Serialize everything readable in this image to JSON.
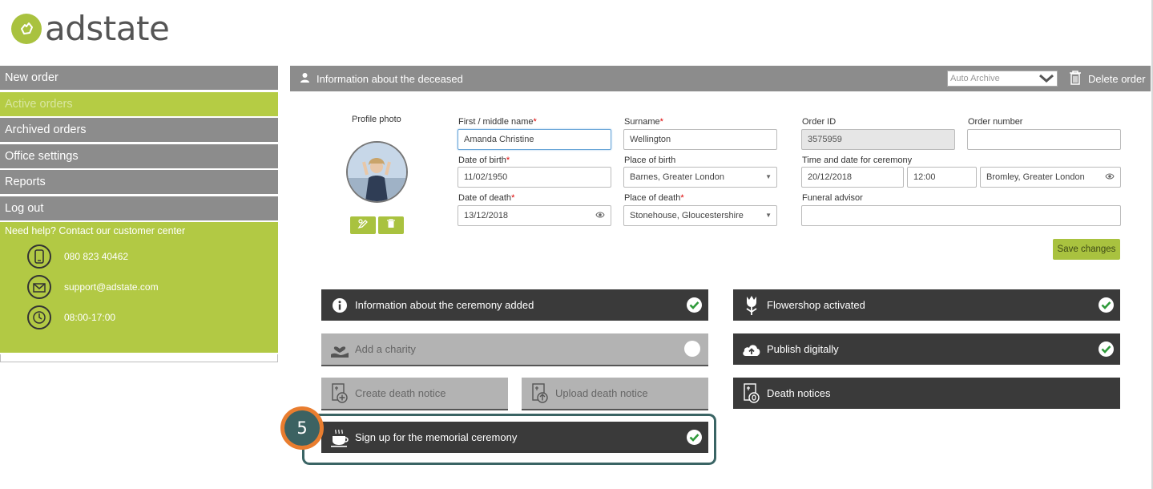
{
  "app": {
    "logo_text": "adstate"
  },
  "sidebar": {
    "items": [
      {
        "label": "New order"
      },
      {
        "label": "Active orders"
      },
      {
        "label": "Archived orders"
      },
      {
        "label": "Office settings"
      },
      {
        "label": "Reports"
      },
      {
        "label": "Log out"
      }
    ],
    "active_index": 1,
    "help": {
      "title": "Need help? Contact our customer center",
      "phone": "080 823 40462",
      "email": "support@adstate.com",
      "hours": "08:00-17:00"
    }
  },
  "header": {
    "title": "Information about the deceased",
    "archive_select": "Auto Archive",
    "delete_label": "Delete order"
  },
  "profile": {
    "label": "Profile photo"
  },
  "form": {
    "first_name": {
      "label": "First / middle name",
      "value": "Amanda Christine",
      "required": "*"
    },
    "surname": {
      "label": "Surname",
      "value": "Wellington",
      "required": "*"
    },
    "order_id": {
      "label": "Order ID",
      "value": "3575959"
    },
    "order_number": {
      "label": "Order number",
      "value": ""
    },
    "date_of_birth": {
      "label": "Date of birth",
      "value": "11/02/1950",
      "required": "*"
    },
    "place_of_birth": {
      "label": "Place of birth",
      "value": "Barnes, Greater London"
    },
    "ceremony": {
      "label": "Time and date for ceremony",
      "date": "20/12/2018",
      "time": "12:00",
      "place": "Bromley, Greater London"
    },
    "date_of_death": {
      "label": "Date of death",
      "value": "13/12/2018",
      "required": "*"
    },
    "place_of_death": {
      "label": "Place of death",
      "value": "Stonehouse, Gloucestershire",
      "required": "*"
    },
    "funeral_advisor": {
      "label": "Funeral advisor",
      "value": ""
    },
    "save_label": "Save changes"
  },
  "tiles": {
    "ceremony_info": "Information about the ceremony added",
    "charity": "Add a charity",
    "create_notice": "Create death notice",
    "upload_notice": "Upload death notice",
    "memorial": "Sign up for the memorial ceremony",
    "flowershop": "Flowershop activated",
    "publish": "Publish digitally",
    "death_notices": "Death notices"
  },
  "step": {
    "number": "5"
  },
  "colors": {
    "accent": "#a9c23f",
    "nav": "#8c8c8c",
    "tile_dark": "#3a3a3a",
    "badge": "#e97d2f",
    "highlight": "#3a6464"
  }
}
